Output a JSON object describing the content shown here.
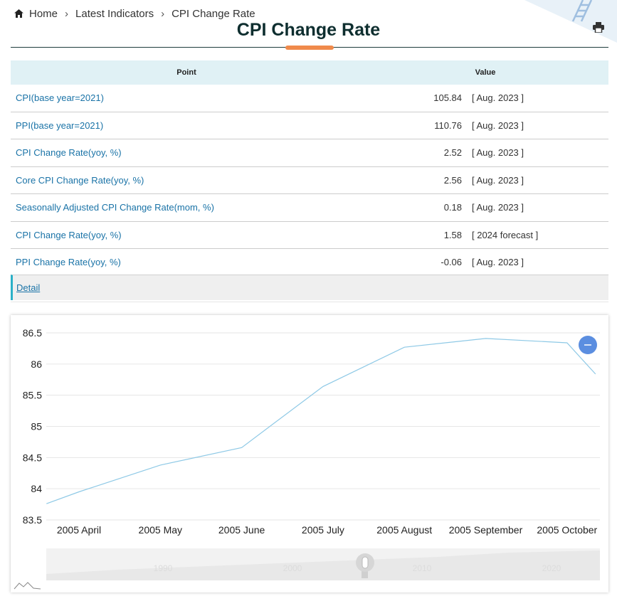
{
  "breadcrumb": {
    "home": "Home",
    "section": "Latest Indicators",
    "current": "CPI Change Rate"
  },
  "page": {
    "title": "CPI Change Rate"
  },
  "table": {
    "headers": {
      "point": "Point",
      "value": "Value"
    },
    "rows": [
      {
        "name": "CPI(base year=2021)",
        "value": "105.84",
        "date": "[ Aug. 2023 ]"
      },
      {
        "name": "PPI(base year=2021)",
        "value": "110.76",
        "date": "[ Aug. 2023 ]"
      },
      {
        "name": "CPI Change Rate(yoy, %)",
        "value": "2.52",
        "date": "[ Aug. 2023 ]"
      },
      {
        "name": "Core CPI Change Rate(yoy, %)",
        "value": "2.56",
        "date": "[ Aug. 2023 ]"
      },
      {
        "name": "Seasonally Adjusted CPI Change Rate(mom, %)",
        "value": "0.18",
        "date": "[ Aug. 2023 ]"
      },
      {
        "name": "CPI Change Rate(yoy, %)",
        "value": "1.58",
        "date": "[ 2024 forecast ]"
      },
      {
        "name": "PPI Change Rate(yoy, %)",
        "value": "-0.06",
        "date": "[ Aug. 2023 ]"
      }
    ],
    "detail_link": "Detail"
  },
  "chart_data": {
    "type": "line",
    "categories": [
      "2005 April",
      "2005 May",
      "2005 June",
      "2005 July",
      "2005 August",
      "2005 September",
      "2005 October"
    ],
    "x": [
      -0.4,
      0,
      1,
      2,
      3,
      4,
      5,
      6,
      6.35
    ],
    "values": [
      83.76,
      83.95,
      84.38,
      84.66,
      85.64,
      86.27,
      86.41,
      86.34,
      85.84
    ],
    "ylim": [
      83.5,
      86.5
    ],
    "yticks": [
      "86.5",
      "86",
      "85.5",
      "85",
      "84.5",
      "84",
      "83.5"
    ],
    "ytick_values": [
      86.5,
      86,
      85.5,
      85,
      84.5,
      84,
      83.5
    ],
    "grid": true,
    "line_color": "#8ec9e6",
    "navigator_labels": [
      "1990",
      "2000",
      "2010",
      "2020"
    ]
  },
  "colors": {
    "link": "#1a73a7",
    "accent": "#f08a4b",
    "header_bg": "#e0f1f5",
    "zoom_button": "#5b8ee0"
  },
  "icons": {
    "home": "home-icon",
    "print": "printer-icon",
    "zoom_out": "minus-icon"
  }
}
